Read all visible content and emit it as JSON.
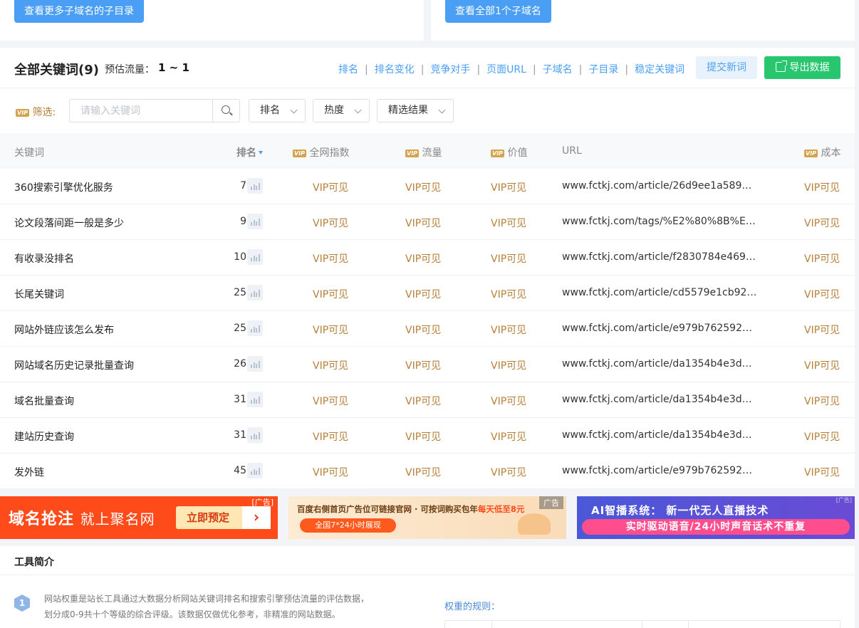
{
  "top_buttons": {
    "more_subdirs": "查看更多子域名的子目录",
    "all_subdomains": "查看全部1个子域名"
  },
  "header": {
    "title": "全部关键词(9)",
    "traffic_label": "预估流量：",
    "traffic_value": "1 ~ 1",
    "sort_links": [
      "排名",
      "排名变化",
      "竞争对手",
      "页面URL",
      "子域名",
      "子目录",
      "稳定关键词"
    ],
    "submit_label": "提交新词",
    "export_label": "导出数据"
  },
  "filter": {
    "vip_badge": "VIP",
    "label": "筛选:",
    "search_placeholder": "请输入关键词",
    "dropdowns": [
      "排名",
      "热度",
      "精选结果"
    ]
  },
  "table": {
    "columns": {
      "keyword": "关键词",
      "rank": "排名",
      "index": "全网指数",
      "traffic": "流量",
      "value": "价值",
      "url": "URL",
      "cost": "成本"
    },
    "rows": [
      {
        "keyword": "360搜索引擎优化服务",
        "rank": "7",
        "index": "VIP可见",
        "traffic": "VIP可见",
        "value": "VIP可见",
        "url": "www.fctkj.com/article/26d9ee1a58908...",
        "cost": "VIP可见"
      },
      {
        "keyword": "论文段落间距一般是多少",
        "rank": "9",
        "index": "VIP可见",
        "traffic": "VIP可见",
        "value": "VIP可见",
        "url": "www.fctkj.com/tags/%E2%80%8B%E8...",
        "cost": "VIP可见"
      },
      {
        "keyword": "有收录没排名",
        "rank": "10",
        "index": "VIP可见",
        "traffic": "VIP可见",
        "value": "VIP可见",
        "url": "www.fctkj.com/article/f2830784e4697...",
        "cost": "VIP可见"
      },
      {
        "keyword": "长尾关键词",
        "rank": "25",
        "index": "VIP可见",
        "traffic": "VIP可见",
        "value": "VIP可见",
        "url": "www.fctkj.com/article/cd5579e1cb92b...",
        "cost": "VIP可见"
      },
      {
        "keyword": "网站外链应该怎么发布",
        "rank": "25",
        "index": "VIP可见",
        "traffic": "VIP可见",
        "value": "VIP可见",
        "url": "www.fctkj.com/article/e979b76259230...",
        "cost": "VIP可见"
      },
      {
        "keyword": "网站域名历史记录批量查询",
        "rank": "26",
        "index": "VIP可见",
        "traffic": "VIP可见",
        "value": "VIP可见",
        "url": "www.fctkj.com/article/da1354b4e3da7...",
        "cost": "VIP可见"
      },
      {
        "keyword": "域名批量查询",
        "rank": "31",
        "index": "VIP可见",
        "traffic": "VIP可见",
        "value": "VIP可见",
        "url": "www.fctkj.com/article/da1354b4e3da7...",
        "cost": "VIP可见"
      },
      {
        "keyword": "建站历史查询",
        "rank": "31",
        "index": "VIP可见",
        "traffic": "VIP可见",
        "value": "VIP可见",
        "url": "www.fctkj.com/article/da1354b4e3da7...",
        "cost": "VIP可见"
      },
      {
        "keyword": "发外链",
        "rank": "45",
        "index": "VIP可见",
        "traffic": "VIP可见",
        "value": "VIP可见",
        "url": "www.fctkj.com/article/e979b76259230...",
        "cost": "VIP可见"
      }
    ]
  },
  "ads": {
    "ad1": {
      "headline": "域名抢注",
      "sub": "就上聚名网",
      "cta": "立即预定",
      "tag": "[广告]"
    },
    "ad2": {
      "headline_a": "百度右侧首页广告位可链接官网 · 可按词购买包年",
      "headline_b": "每天低至8元",
      "pill": "全国7*24小时展现",
      "tag": "广告"
    },
    "ad3": {
      "headline": "AI智播系统：  新一代无人直播技术",
      "pill": "实时驱动语音/24小时声音话术不重复",
      "tag": "[广告]"
    }
  },
  "intro": {
    "title": "工具简介",
    "step": "1",
    "line1": "网站权重是站长工具通过大数据分析网站关键词排名和搜索引擎预估流量的评估数据，",
    "line2": "划分成0-9共十个等级的综合评级。该数据仅做优化参考，非精准的网站数据。",
    "rules_title": "权重的规则："
  },
  "colors": {
    "accent_blue": "#4a9ff5",
    "export_green": "#28c76f",
    "vip_gold": "#b5803a"
  }
}
